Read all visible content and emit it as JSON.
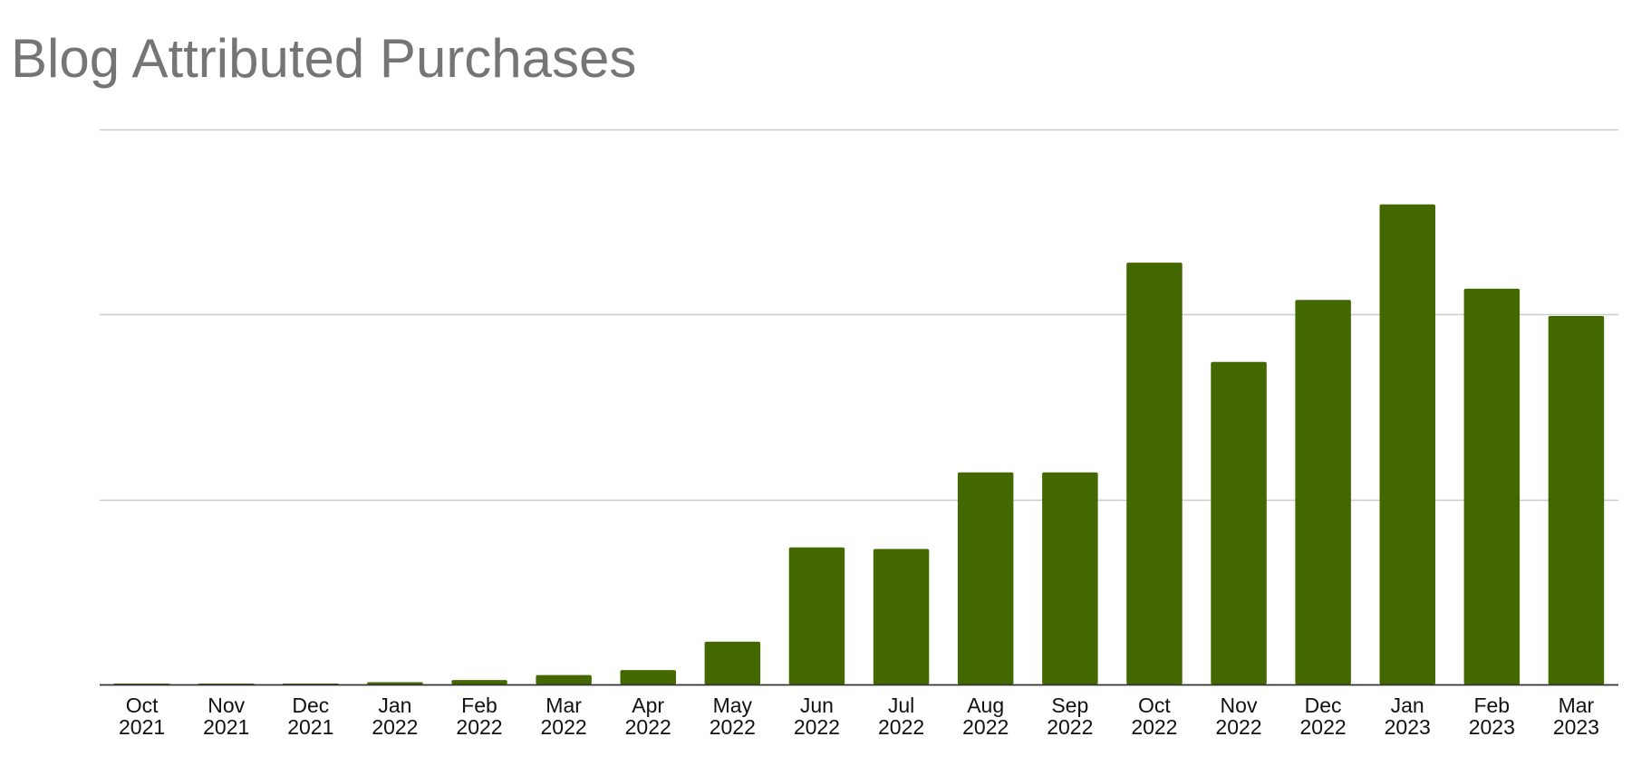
{
  "chart_data": {
    "type": "bar",
    "title": "Blog Attributed Purchases",
    "xlabel": "",
    "ylabel": "",
    "categories": [
      [
        "Oct",
        "2021"
      ],
      [
        "Nov",
        "2021"
      ],
      [
        "Dec",
        "2021"
      ],
      [
        "Jan",
        "2022"
      ],
      [
        "Feb",
        "2022"
      ],
      [
        "Mar",
        "2022"
      ],
      [
        "Apr",
        "2022"
      ],
      [
        "May",
        "2022"
      ],
      [
        "Jun",
        "2022"
      ],
      [
        "Jul",
        "2022"
      ],
      [
        "Aug",
        "2022"
      ],
      [
        "Sep",
        "2022"
      ],
      [
        "Oct",
        "2022"
      ],
      [
        "Nov",
        "2022"
      ],
      [
        "Dec",
        "2022"
      ],
      [
        "Jan",
        "2023"
      ],
      [
        "Feb",
        "2023"
      ],
      [
        "Mar",
        "2023"
      ]
    ],
    "values": [
      0,
      0,
      0,
      0.4,
      0.8,
      1.7,
      2.6,
      7.7,
      24.7,
      24.4,
      38.2,
      38.2,
      76.0,
      58.1,
      69.3,
      86.5,
      71.3,
      66.4
    ],
    "ylim": [
      0,
      100
    ],
    "gridlines": [
      0,
      33.33,
      66.67,
      100
    ],
    "y_tick_labels_shown": false,
    "legend": "none",
    "grid": true,
    "bar_color": "#436800",
    "gridline_color": "#cccccc",
    "axis_color": "#333333",
    "title_color": "#757575"
  }
}
